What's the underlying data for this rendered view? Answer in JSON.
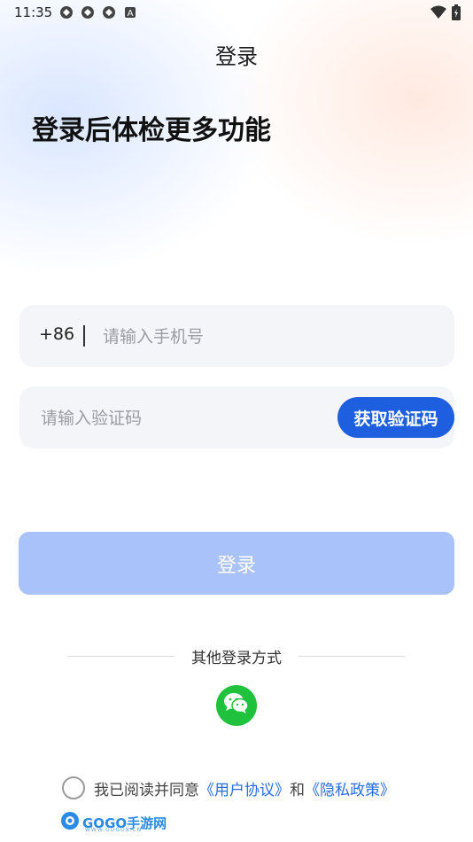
{
  "status_bar": {
    "time": "11:35",
    "icons": [
      "sync-icon",
      "sync-icon",
      "sync-icon",
      "a-letter-icon"
    ],
    "right_icons": [
      "wifi-icon",
      "battery-icon"
    ]
  },
  "header": {
    "title": "登录"
  },
  "headline": "登录后体检更多功能",
  "phone_field": {
    "country_code": "+86",
    "placeholder": "请输入手机号",
    "value": ""
  },
  "code_field": {
    "placeholder": "请输入验证码",
    "value": "",
    "get_code_label": "获取验证码"
  },
  "login_button": {
    "label": "登录",
    "enabled": false
  },
  "other_login": {
    "label": "其他登录方式",
    "methods": [
      "wechat-icon"
    ]
  },
  "agreement": {
    "checked": false,
    "prefix": "我已阅读并同意",
    "user_agreement": "《用户协议》",
    "connector": "和",
    "privacy_policy": "《隐私政策》"
  },
  "watermark": {
    "text": "GOGO手游网",
    "sub": "WWW.GOGO8.CN"
  },
  "colors": {
    "accent": "#1e5fe0",
    "login_disabled": "#a9c3fa",
    "link": "#2a6be6",
    "wechat": "#1fc13d"
  }
}
